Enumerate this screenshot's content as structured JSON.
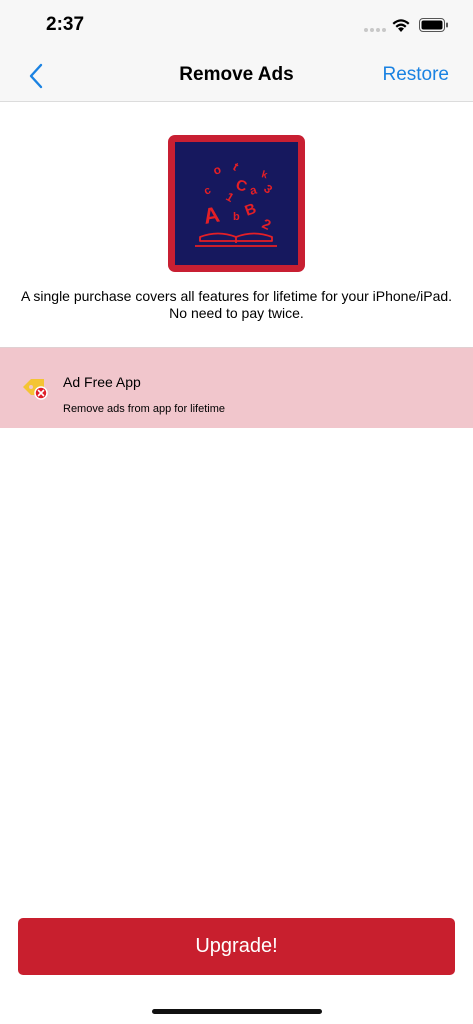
{
  "status_bar": {
    "time": "2:37"
  },
  "nav": {
    "title": "Remove Ads",
    "restore_label": "Restore",
    "back_icon": "chevron-left-icon"
  },
  "logo": {
    "icon": "book-with-letters-icon",
    "letters": [
      "o",
      "t",
      "k",
      "c",
      "1",
      "C",
      "a",
      "3",
      "A",
      "b",
      "B",
      "2"
    ]
  },
  "description": {
    "line1": "A single purchase covers all features for lifetime for your iPhone/iPad.",
    "line2": "No need to pay twice."
  },
  "feature": {
    "icon": "no-ads-tag-icon",
    "title": "Ad Free App",
    "subtitle": "Remove ads from app for lifetime"
  },
  "upgrade_label": "Upgrade!",
  "colors": {
    "accent_blue": "#1a82e2",
    "brand_red": "#c81f2e",
    "logo_bg": "#16185e",
    "feature_bg": "#f1c6cc"
  }
}
